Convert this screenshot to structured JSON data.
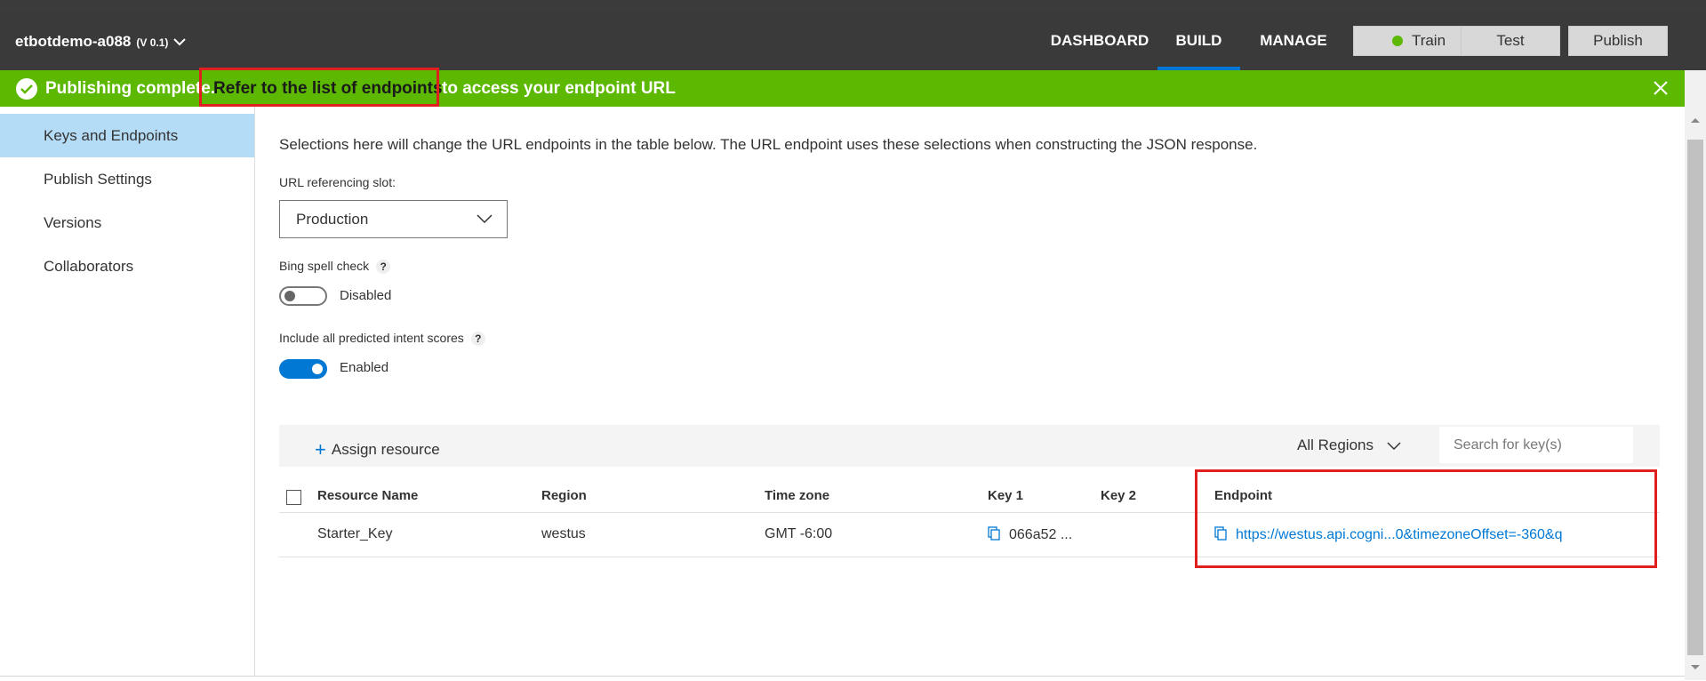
{
  "app": {
    "name": "etbotdemo-a088",
    "version": "(V 0.1)"
  },
  "nav": {
    "items": [
      "DASHBOARD",
      "BUILD",
      "MANAGE"
    ],
    "active": "BUILD"
  },
  "buttons": {
    "train": "Train",
    "test": "Test",
    "publish": "Publish"
  },
  "banner": {
    "prefix": "Publishing complete.",
    "link": "Refer to the list of endpoints",
    "suffix": "to access your endpoint URL"
  },
  "sidebar": {
    "items": [
      "Keys and Endpoints",
      "Publish Settings",
      "Versions",
      "Collaborators"
    ],
    "active": "Keys and Endpoints"
  },
  "settings": {
    "description": "Selections here will change the URL endpoints in the table below. The URL endpoint uses these selections when constructing the JSON response.",
    "slot_label": "URL referencing slot:",
    "slot_value": "Production",
    "spell_label": "Bing spell check",
    "spell_state": "Disabled",
    "intent_label": "Include all predicted intent scores",
    "intent_state": "Enabled",
    "help": "?"
  },
  "toolbar": {
    "assign": "Assign resource",
    "regions": "All Regions",
    "search_placeholder": "Search for key(s)"
  },
  "table": {
    "headers": [
      "Resource Name",
      "Region",
      "Time zone",
      "Key 1",
      "Key 2",
      "Endpoint"
    ],
    "rows": [
      {
        "resource": "Starter_Key",
        "region": "westus",
        "timezone": "GMT -6:00",
        "key1": "066a52 ...",
        "key2": "",
        "endpoint": "https://westus.api.cogni...0&timezoneOffset=-360&q"
      }
    ]
  },
  "colors": {
    "accent": "#0078d4",
    "success": "#5cb800",
    "highlight": "#e01f1f",
    "appbar": "#3a3a3a"
  }
}
